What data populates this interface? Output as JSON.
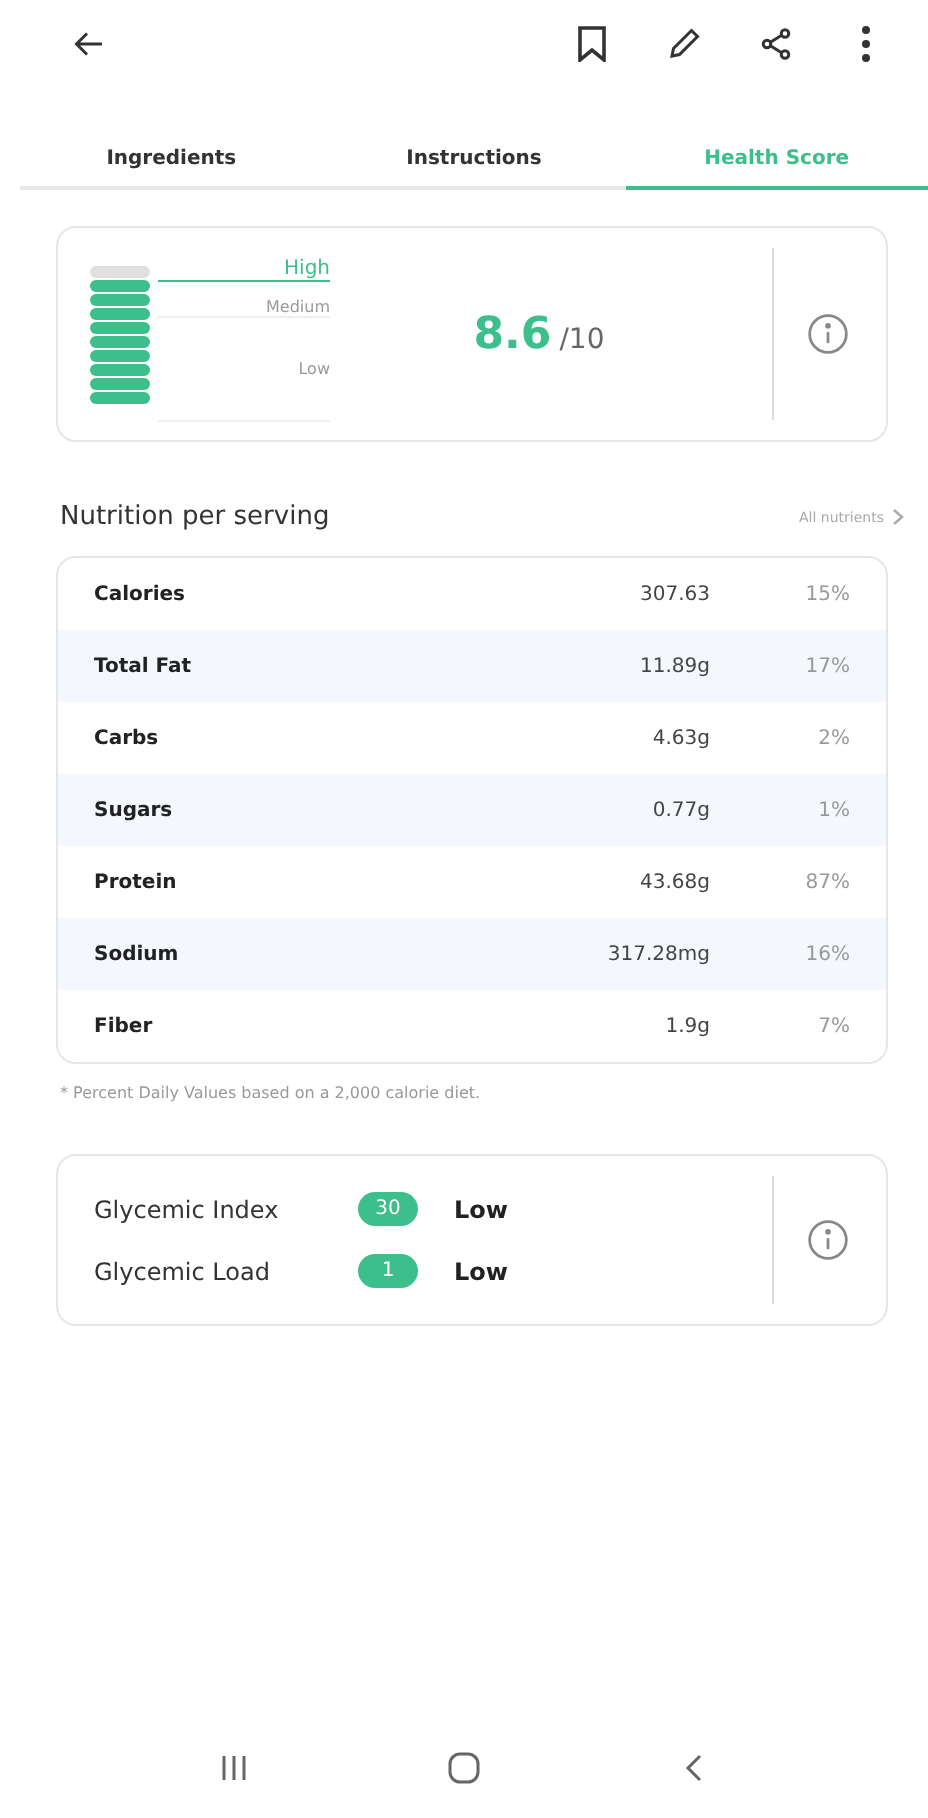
{
  "tabs": [
    {
      "label": "Ingredients",
      "selected": false
    },
    {
      "label": "Instructions",
      "selected": false
    },
    {
      "label": "Health Score",
      "selected": true
    }
  ],
  "score": {
    "meter": {
      "level": 0.9,
      "bands": [
        {
          "label": "High",
          "selected": true
        },
        {
          "label": "Medium",
          "selected": false
        },
        {
          "label": "Low",
          "selected": false
        }
      ]
    },
    "value": "8.6",
    "max": "/10"
  },
  "nutrition": {
    "title": "Nutrition per serving",
    "link": "All nutrients",
    "rows": [
      {
        "name": "Calories",
        "amount": "307.63",
        "percent": "15%"
      },
      {
        "name": "Total Fat",
        "amount": "11.89g",
        "percent": "17%"
      },
      {
        "name": "Carbs",
        "amount": "4.63g",
        "percent": "2%"
      },
      {
        "name": "Sugars",
        "amount": "0.77g",
        "percent": "1%"
      },
      {
        "name": "Protein",
        "amount": "43.68g",
        "percent": "87%"
      },
      {
        "name": "Sodium",
        "amount": "317.28mg",
        "percent": "16%"
      },
      {
        "name": "Fiber",
        "amount": "1.9g",
        "percent": "7%"
      }
    ],
    "footnote": "* Percent Daily Values based on a 2,000 calorie diet."
  },
  "glycemic": [
    {
      "label": "Glycemic Index",
      "value": "30",
      "rating": "Low"
    },
    {
      "label": "Glycemic Load",
      "value": "1",
      "rating": "Low"
    }
  ]
}
